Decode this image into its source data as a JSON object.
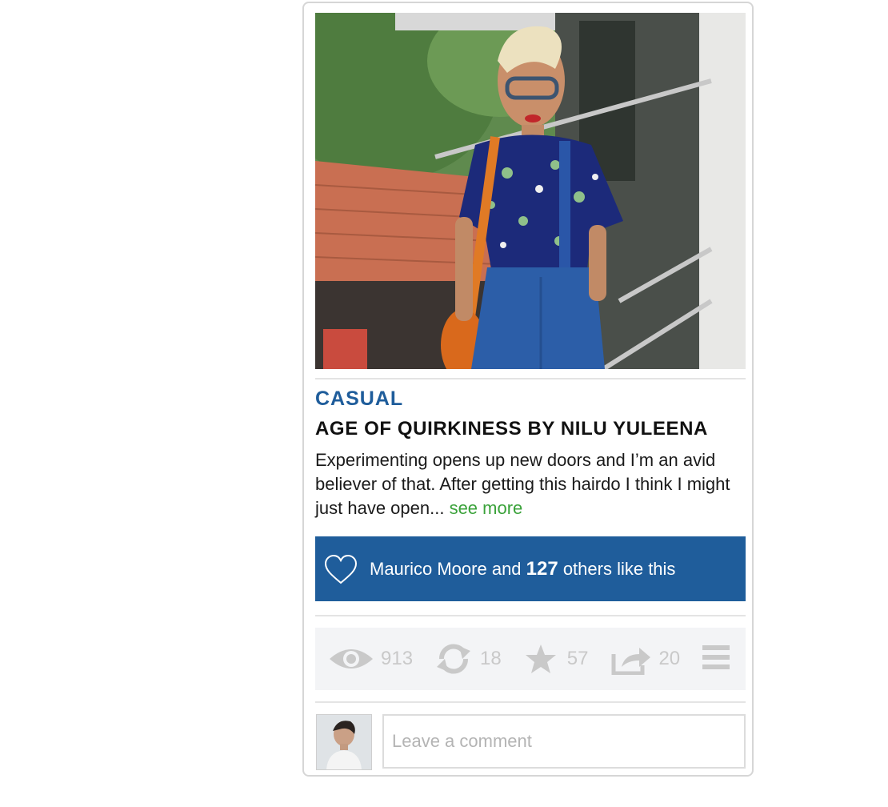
{
  "post": {
    "category": "CASUAL",
    "title": "AGE OF QUIRKINESS BY NILU YULEENA",
    "excerpt": "Experimenting opens up new doors and I’m an avid believer of that. After getting this hairdo I think I might just have open... ",
    "see_more": "see more"
  },
  "likes": {
    "name": "Maurico Moore",
    "middle": " and ",
    "count": "127",
    "suffix": " others like this",
    "icon": "heart-icon"
  },
  "stats": {
    "views": "913",
    "reposts": "18",
    "favorites": "57",
    "shares": "20"
  },
  "comment": {
    "placeholder": "Leave a comment"
  },
  "colors": {
    "accent": "#1f5d9b",
    "link": "#3aa23a",
    "stat_icon": "#c9c9c9"
  }
}
